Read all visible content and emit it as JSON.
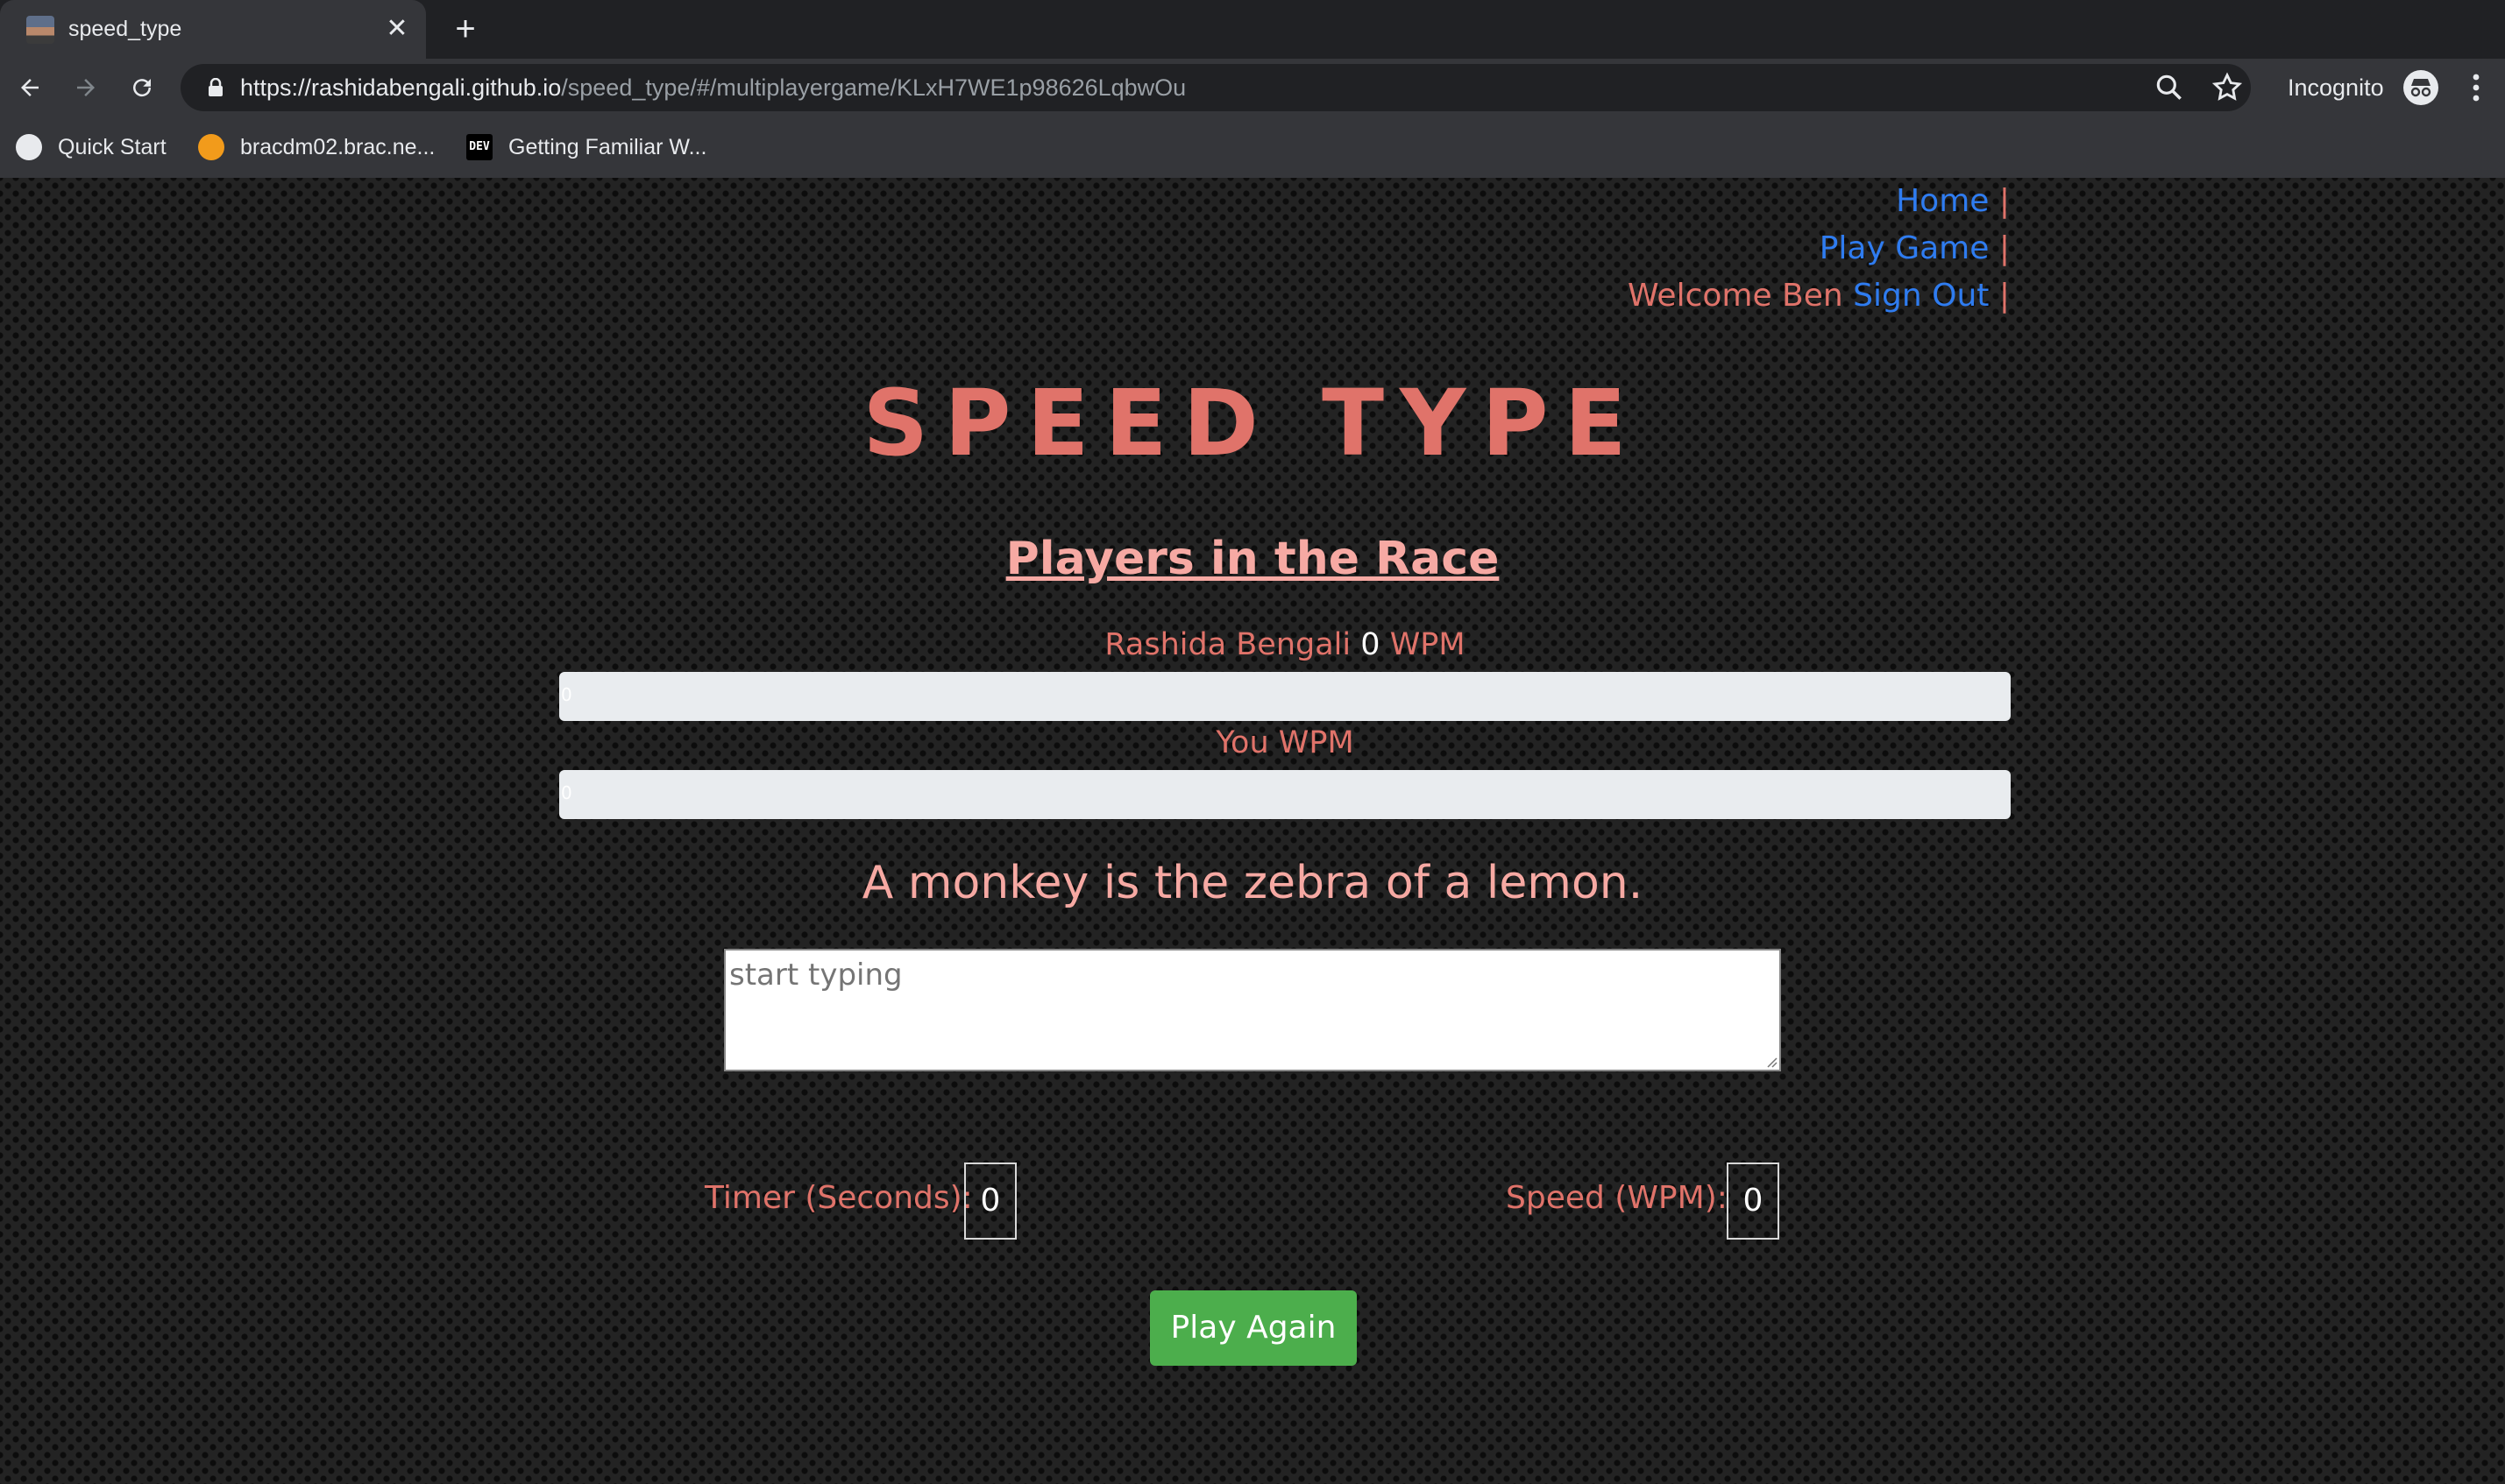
{
  "browser": {
    "tab_title": "speed_type",
    "url_host": "https://rashidabengali.github.io",
    "url_path": "/speed_type/#/multiplayergame/KLxH7WE1p98626LqbwOu",
    "profile_label": "Incognito",
    "bookmarks": [
      "Quick Start",
      "bracdm02.brac.ne...",
      "Getting Familiar W..."
    ]
  },
  "nav": {
    "home": "Home",
    "play_game": "Play Game",
    "welcome": "Welcome Ben",
    "sign_out": "Sign Out",
    "separator": "|"
  },
  "game": {
    "title": "SPEED TYPE",
    "players_heading": "Players in the Race",
    "opponent_name": "Rashida Bengali",
    "opponent_wpm": "0",
    "wpm_unit": "WPM",
    "you_label": "You WPM",
    "opponent_progress": 0,
    "opponent_progress_label": "0",
    "you_progress": 0,
    "you_progress_label": "0",
    "sentence": "A monkey is the zebra of a lemon.",
    "input_placeholder": "start typing",
    "timer_label": "Timer (Seconds):",
    "timer_value": "0",
    "speed_label": "Speed (WPM):",
    "speed_value": "0",
    "play_again": "Play Again"
  },
  "colors": {
    "accent": "#e0736a",
    "link": "#2f7cf0",
    "button": "#4cae4c"
  }
}
